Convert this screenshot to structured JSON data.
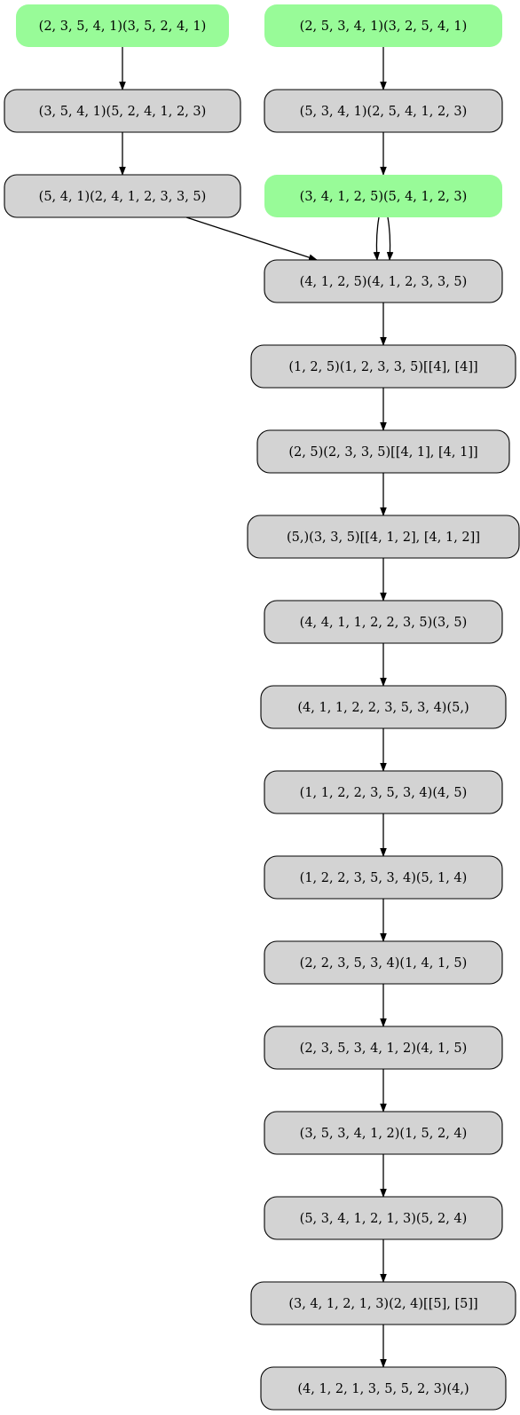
{
  "colors": {
    "start": "#98fb98",
    "normal": "#d3d3d3",
    "stroke": "#000000",
    "edge": "#000000"
  },
  "nodes": [
    {
      "id": "a1",
      "label": "(2, 3, 5, 4, 1)(3, 5, 2, 4, 1)",
      "kind": "start"
    },
    {
      "id": "b1",
      "label": "(2, 5, 3, 4, 1)(3, 2, 5, 4, 1)",
      "kind": "start"
    },
    {
      "id": "a2",
      "label": "(3, 5, 4, 1)(5, 2, 4, 1, 2, 3)",
      "kind": "normal"
    },
    {
      "id": "b2",
      "label": "(5, 3, 4, 1)(2, 5, 4, 1, 2, 3)",
      "kind": "normal"
    },
    {
      "id": "a3",
      "label": "(5, 4, 1)(2, 4, 1, 2, 3, 3, 5)",
      "kind": "normal"
    },
    {
      "id": "b3",
      "label": "(3, 4, 1, 2, 5)(5, 4, 1, 2, 3)",
      "kind": "start"
    },
    {
      "id": "n4",
      "label": "(4, 1, 2, 5)(4, 1, 2, 3, 3, 5)",
      "kind": "normal"
    },
    {
      "id": "n5",
      "label": "(1, 2, 5)(1, 2, 3, 3, 5)[[4], [4]]",
      "kind": "normal"
    },
    {
      "id": "n6",
      "label": "(2, 5)(2, 3, 3, 5)[[4, 1], [4, 1]]",
      "kind": "normal"
    },
    {
      "id": "n7",
      "label": "(5,)(3, 3, 5)[[4, 1, 2], [4, 1, 2]]",
      "kind": "normal"
    },
    {
      "id": "n8",
      "label": "(4, 4, 1, 1, 2, 2, 3, 5)(3, 5)",
      "kind": "normal"
    },
    {
      "id": "n9",
      "label": "(4, 1, 1, 2, 2, 3, 5, 3, 4)(5,)",
      "kind": "normal"
    },
    {
      "id": "n10",
      "label": "(1, 1, 2, 2, 3, 5, 3, 4)(4, 5)",
      "kind": "normal"
    },
    {
      "id": "n11",
      "label": "(1, 2, 2, 3, 5, 3, 4)(5, 1, 4)",
      "kind": "normal"
    },
    {
      "id": "n12",
      "label": "(2, 2, 3, 5, 3, 4)(1, 4, 1, 5)",
      "kind": "normal"
    },
    {
      "id": "n13",
      "label": "(2, 3, 5, 3, 4, 1, 2)(4, 1, 5)",
      "kind": "normal"
    },
    {
      "id": "n14",
      "label": "(3, 5, 3, 4, 1, 2)(1, 5, 2, 4)",
      "kind": "normal"
    },
    {
      "id": "n15",
      "label": "(5, 3, 4, 1, 2, 1, 3)(5, 2, 4)",
      "kind": "normal"
    },
    {
      "id": "n16",
      "label": "(3, 4, 1, 2, 1, 3)(2, 4)[[5], [5]]",
      "kind": "normal"
    },
    {
      "id": "n17",
      "label": "(4, 1, 2, 1, 3, 5, 5, 2, 3)(4,)",
      "kind": "normal"
    }
  ],
  "edges": [
    {
      "from": "a1",
      "to": "a2"
    },
    {
      "from": "a2",
      "to": "a3"
    },
    {
      "from": "a3",
      "to": "n4"
    },
    {
      "from": "b1",
      "to": "b2"
    },
    {
      "from": "b2",
      "to": "b3"
    },
    {
      "from": "b3",
      "to": "n4"
    },
    {
      "from": "b3",
      "to": "n4"
    },
    {
      "from": "n4",
      "to": "n5"
    },
    {
      "from": "n5",
      "to": "n6"
    },
    {
      "from": "n6",
      "to": "n7"
    },
    {
      "from": "n7",
      "to": "n8"
    },
    {
      "from": "n8",
      "to": "n9"
    },
    {
      "from": "n9",
      "to": "n10"
    },
    {
      "from": "n10",
      "to": "n11"
    },
    {
      "from": "n11",
      "to": "n12"
    },
    {
      "from": "n12",
      "to": "n13"
    },
    {
      "from": "n13",
      "to": "n14"
    },
    {
      "from": "n14",
      "to": "n15"
    },
    {
      "from": "n15",
      "to": "n16"
    },
    {
      "from": "n16",
      "to": "n17"
    }
  ]
}
